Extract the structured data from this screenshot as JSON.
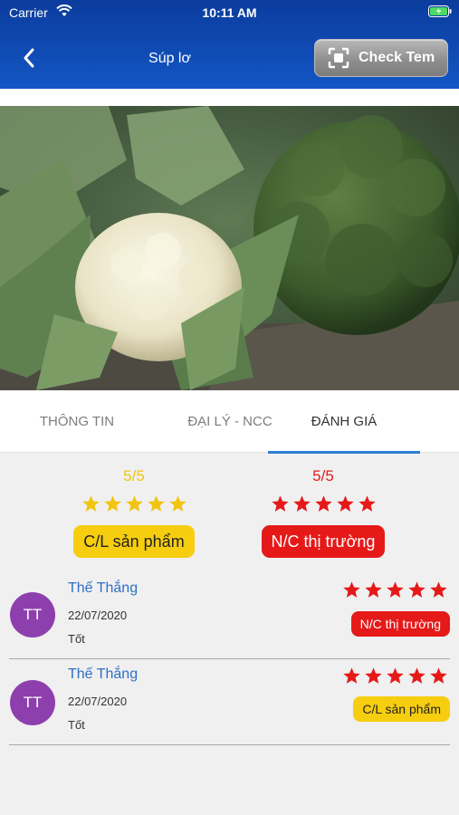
{
  "status_bar": {
    "carrier": "Carrier",
    "time": "10:11 AM"
  },
  "header": {
    "title": "Súp lơ",
    "check_button": "Check Tem"
  },
  "tabs": [
    {
      "label": "THÔNG TIN",
      "active": false
    },
    {
      "label": "ĐẠI LÝ - NCC",
      "active": false
    },
    {
      "label": "ĐÁNH GIÁ",
      "active": true
    }
  ],
  "summary": [
    {
      "score": "5/5",
      "stars": 5,
      "label": "C/L sản phẩm",
      "color": "#f1c40f"
    },
    {
      "score": "5/5",
      "stars": 5,
      "label": "N/C thị trường",
      "color": "#e61919"
    }
  ],
  "reviews": [
    {
      "initials": "TT",
      "name": "Thế Thắng",
      "date": "22/07/2020",
      "text": "Tốt",
      "stars": 5,
      "tag": "N/C thị trường"
    },
    {
      "initials": "TT",
      "name": "Thế Thắng",
      "date": "22/07/2020",
      "text": "Tốt",
      "stars": 5,
      "tag": "C/L sản phẩm"
    }
  ],
  "colors": {
    "header": "#1356c4",
    "yellow": "#f1c40f",
    "red": "#e61919",
    "avatar": "#8e3fae",
    "tab_underline": "#2f7fd6"
  },
  "icons": [
    "back-chevron-icon",
    "scan-icon",
    "wifi-icon",
    "battery-icon",
    "star-icon"
  ]
}
